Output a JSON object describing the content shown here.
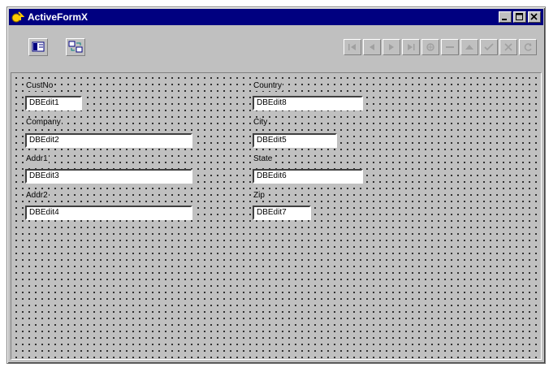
{
  "window": {
    "title": "ActiveFormX"
  },
  "toolbar": {
    "left_buttons": [
      "form-view-icon",
      "data-view-icon"
    ],
    "nav_buttons": [
      "first-record-icon",
      "prior-record-icon",
      "next-record-icon",
      "last-record-icon",
      "insert-record-icon",
      "delete-record-icon",
      "edit-record-icon",
      "post-record-icon",
      "cancel-record-icon",
      "refresh-record-icon"
    ]
  },
  "form": {
    "fields": [
      {
        "label": "CustNo",
        "value": "DBEdit1"
      },
      {
        "label": "Company",
        "value": "DBEdit2"
      },
      {
        "label": "Addr1",
        "value": "DBEdit3"
      },
      {
        "label": "Addr2",
        "value": "DBEdit4"
      },
      {
        "label": "Country",
        "value": "DBEdit8"
      },
      {
        "label": "City",
        "value": "DBEdit5"
      },
      {
        "label": "State",
        "value": "DBEdit6"
      },
      {
        "label": "Zip",
        "value": "DBEdit7"
      }
    ]
  }
}
